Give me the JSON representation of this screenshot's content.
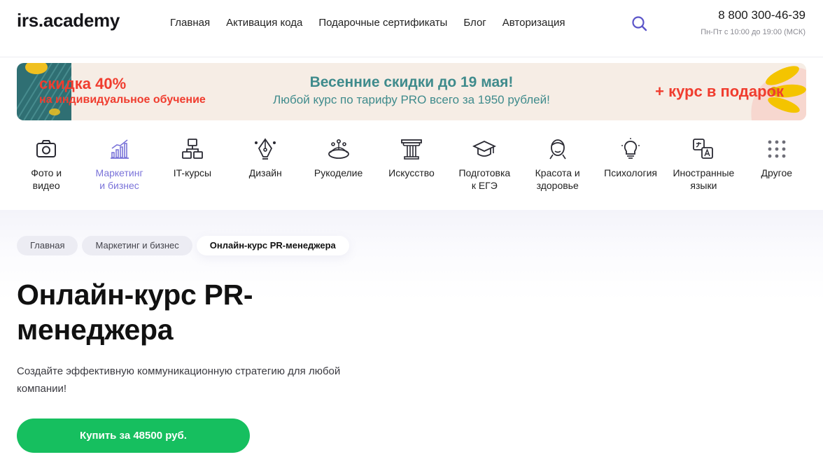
{
  "header": {
    "logo": "irs.academy",
    "nav": [
      "Главная",
      "Активация кода",
      "Подарочные сертификаты",
      "Блог",
      "Авторизация"
    ],
    "phone": "8 800 300-46-39",
    "hours": "Пн-Пт с 10:00 до 19:00 (МСК)",
    "search_icon": "search-icon"
  },
  "banner": {
    "left_line1": "скидка 40%",
    "left_line2": "на индивидуальное обучение",
    "mid_line1": "Весенние скидки до 19 мая!",
    "mid_line2": "Любой курс по тарифу PRO всего за 1950 рублей!",
    "right": "+ курс в подарок"
  },
  "categories": [
    {
      "label": "Фото и\nвидео",
      "icon": "camera-icon",
      "active": false
    },
    {
      "label": "Маркетинг\nи бизнес",
      "icon": "chart-icon",
      "active": true
    },
    {
      "label": "IT-курсы",
      "icon": "network-icon",
      "active": false
    },
    {
      "label": "Дизайн",
      "icon": "pen-tool-icon",
      "active": false
    },
    {
      "label": "Рукоделие",
      "icon": "embroidery-icon",
      "active": false
    },
    {
      "label": "Искусство",
      "icon": "column-icon",
      "active": false
    },
    {
      "label": "Подготовка\nк ЕГЭ",
      "icon": "graduation-cap-icon",
      "active": false
    },
    {
      "label": "Красота и\nздоровье",
      "icon": "face-icon",
      "active": false
    },
    {
      "label": "Психология",
      "icon": "lightbulb-icon",
      "active": false
    },
    {
      "label": "Иностранные\nязыки",
      "icon": "translate-icon",
      "active": false
    },
    {
      "label": "Другое",
      "icon": "grid-dots-icon",
      "active": false
    }
  ],
  "breadcrumbs": [
    "Главная",
    "Маркетинг и бизнес",
    "Онлайн-курс PR-менеджера"
  ],
  "hero": {
    "title": "Онлайн-курс PR-менеджера",
    "subtitle": "Создайте эффективную коммуникационную стратегию для любой компании!",
    "buy_label": "Купить за 48500 руб."
  },
  "colors": {
    "accent": "#7a73d9",
    "buy_button": "#16bf5f",
    "banner_red": "#f03c2e",
    "banner_teal": "#3f8b8c",
    "banner_bg": "#f6ede5"
  }
}
